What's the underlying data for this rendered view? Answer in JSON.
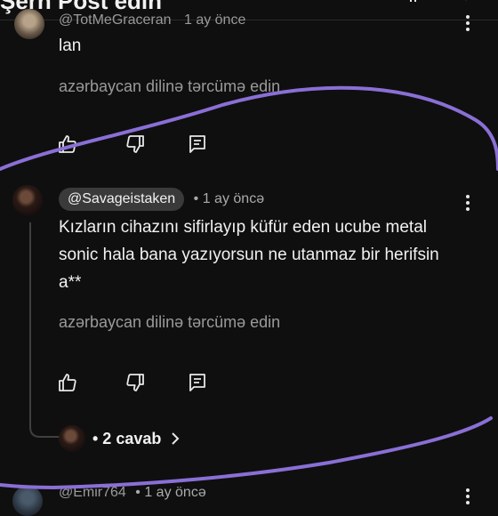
{
  "header": {
    "title": "Şerh Post edin"
  },
  "comments": [
    {
      "handle": "@TotMeGraceran",
      "time": "1 ay önce",
      "text": "lan",
      "translate": "azərbaycan dilinə tərcümə edin"
    },
    {
      "handle": "@Savageistaken",
      "time": "• 1 ay öncə",
      "text": "Kızların cihazını sifirlayıp küfür eden ucube metal sonic hala bana yazıyorsun ne utanmaz bir herifsin a**",
      "translate": "azərbaycan dilinə tərcümə edin",
      "replies": "• 2 cavab"
    },
    {
      "handle": "@Emir764",
      "time": "• 1 ay öncə"
    }
  ],
  "annotation_color": "#8a6fd6",
  "icons": [
    "like-icon",
    "dislike-icon",
    "reply-icon",
    "more-icon",
    "chevron-right-icon"
  ]
}
